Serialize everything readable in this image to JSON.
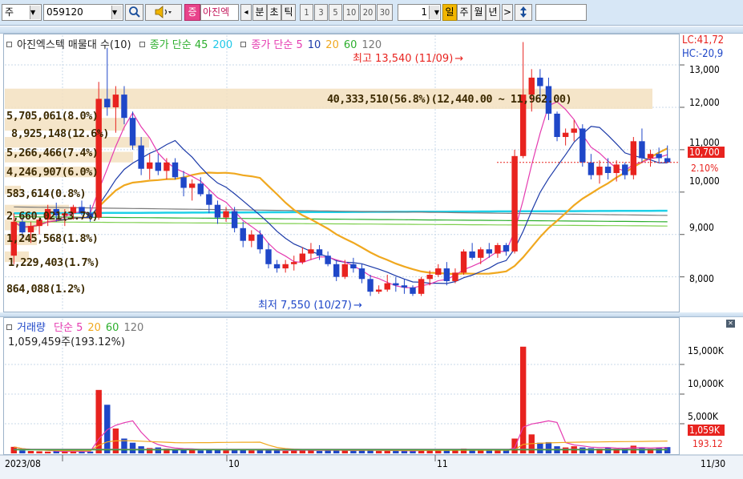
{
  "toolbar": {
    "market_code": "주",
    "stock_code": "059120",
    "search_icon": "magnifier-icon",
    "sound_icon": "speaker-icon",
    "kind_badge": "증",
    "stock_name": "아진엑",
    "prev_arrow": "◂",
    "unit_minute": "분",
    "unit_second": "초",
    "unit_tick": "틱",
    "intervals": [
      "1",
      "3",
      "5",
      "10",
      "20",
      "30"
    ],
    "interval_value": "1",
    "period_day": "일",
    "period_week": "주",
    "period_month": "월",
    "period_year": "년",
    "next_arrow": ">",
    "updown_icon": "up-down-arrow-icon"
  },
  "price_panel": {
    "legend_title": "아진엑스텍 매물대 수(10)",
    "ma_long_label": "종가 단순 45",
    "ma_long_value": "200",
    "ma_short_label": "종가 단순 5",
    "ma_short_periods": [
      "10",
      "20",
      "60",
      "120"
    ],
    "lc_label": "LC:41,72",
    "hc_label": "HC:-20,9",
    "y_ticks": [
      "13,000",
      "12,000",
      "11,000",
      "10,000",
      "9,000",
      "8,000"
    ],
    "current_price": "10,700",
    "current_change": "2.10%",
    "high_annotation": "최고 13,540 (11/09)",
    "low_annotation": "최저 7,550 (10/27)",
    "range_band_label": "40,333,510(56.8%)(12,440.00 ~ 11,962.00)",
    "profile_labels": [
      "5,705,061(8.0%)",
      "8,925,148(12.6%)",
      "5,266,466(7.4%)",
      "4,246,907(6.0%)",
      "583,614(0.8%)",
      "2,660,021(3.7%)",
      "1,245,568(1.8%)",
      "1,229,403(1.7%)",
      "864,088(1.2%)"
    ]
  },
  "volume_panel": {
    "legend_title": "거래량",
    "ma_label": "단순 5",
    "ma_periods": [
      "20",
      "60",
      "120"
    ],
    "current_volume": "1,059,459주(193.12%)",
    "y_ticks": [
      "15,000K",
      "10,000K",
      "5,000K"
    ],
    "current_tag": "1,059K",
    "ratio_tag": "193.12"
  },
  "x_axis": {
    "labels": [
      "2023/08",
      "10",
      "11",
      "11/30"
    ]
  },
  "colors": {
    "up": "#e8231f",
    "down": "#1f47c8",
    "ma5": "#e53bb0",
    "ma10": "#1c3aa8",
    "ma20": "#f0a81f",
    "ma60": "#2cae2c",
    "ma120": "#7a7a7a",
    "ma200": "#1ed0e8",
    "profile_band": "#f3e1c0",
    "toolbar_bg": "#d7e7f6"
  },
  "chart_data": {
    "type": "candlestick",
    "price_axis": {
      "ylim": [
        7200,
        13700
      ],
      "ticks": [
        13000,
        12000,
        11000,
        10000,
        9000,
        8000
      ]
    },
    "candles": [
      [
        8500,
        9500,
        8300,
        9300
      ],
      [
        9300,
        9400,
        8900,
        9050
      ],
      [
        9050,
        9300,
        8800,
        9200
      ],
      [
        9200,
        9400,
        9000,
        9350
      ],
      [
        9350,
        9700,
        9200,
        9600
      ],
      [
        9600,
        9750,
        9300,
        9450
      ],
      [
        9450,
        9600,
        9200,
        9500
      ],
      [
        9500,
        9700,
        9350,
        9650
      ],
      [
        9650,
        9800,
        9450,
        9500
      ],
      [
        9500,
        9700,
        9300,
        9400
      ],
      [
        9400,
        12600,
        9350,
        12200
      ],
      [
        12200,
        13400,
        11800,
        12000
      ],
      [
        12000,
        12500,
        11400,
        12300
      ],
      [
        12300,
        12500,
        11600,
        11750
      ],
      [
        11750,
        11900,
        11000,
        11100
      ],
      [
        11100,
        11300,
        10400,
        10550
      ],
      [
        10550,
        10900,
        10300,
        10700
      ],
      [
        10700,
        10900,
        10400,
        10500
      ],
      [
        10500,
        10800,
        10300,
        10700
      ],
      [
        10700,
        10800,
        10300,
        10350
      ],
      [
        10350,
        10500,
        9900,
        10100
      ],
      [
        10100,
        10300,
        9800,
        10200
      ],
      [
        10200,
        10350,
        9900,
        9950
      ],
      [
        9950,
        10050,
        9500,
        9700
      ],
      [
        9700,
        9800,
        9250,
        9400
      ],
      [
        9400,
        9650,
        9300,
        9550
      ],
      [
        9550,
        9650,
        9050,
        9150
      ],
      [
        9150,
        9300,
        8700,
        8850
      ],
      [
        8850,
        9100,
        8700,
        9000
      ],
      [
        9000,
        9100,
        8550,
        8650
      ],
      [
        8650,
        8800,
        8200,
        8300
      ],
      [
        8300,
        8400,
        8100,
        8200
      ],
      [
        8200,
        8400,
        8100,
        8300
      ],
      [
        8300,
        8500,
        8150,
        8350
      ],
      [
        8350,
        8700,
        8300,
        8550
      ],
      [
        8550,
        8800,
        8400,
        8650
      ],
      [
        8650,
        8750,
        8400,
        8500
      ],
      [
        8500,
        8600,
        8250,
        8300
      ],
      [
        8300,
        8400,
        7900,
        8000
      ],
      [
        8000,
        8400,
        7950,
        8300
      ],
      [
        8300,
        8450,
        8100,
        8200
      ],
      [
        8200,
        8300,
        7850,
        7950
      ],
      [
        7950,
        8050,
        7550,
        7650
      ],
      [
        7650,
        7800,
        7600,
        7700
      ],
      [
        7700,
        8050,
        7650,
        7850
      ],
      [
        7850,
        8000,
        7650,
        7800
      ],
      [
        7800,
        7950,
        7600,
        7750
      ],
      [
        7750,
        7800,
        7550,
        7600
      ],
      [
        7600,
        8000,
        7550,
        7950
      ],
      [
        7950,
        8150,
        7800,
        8050
      ],
      [
        8050,
        8300,
        8000,
        8200
      ],
      [
        8200,
        8350,
        7800,
        7900
      ],
      [
        7900,
        8200,
        7850,
        8100
      ],
      [
        8100,
        8650,
        8050,
        8600
      ],
      [
        8600,
        8800,
        8400,
        8450
      ],
      [
        8450,
        8700,
        8300,
        8650
      ],
      [
        8650,
        8800,
        8450,
        8550
      ],
      [
        8550,
        8800,
        8450,
        8750
      ],
      [
        8750,
        8800,
        8500,
        8600
      ],
      [
        8600,
        11000,
        8550,
        10850
      ],
      [
        10850,
        13540,
        10800,
        12300
      ],
      [
        12300,
        12900,
        11900,
        12700
      ],
      [
        12700,
        12900,
        12200,
        12500
      ],
      [
        12500,
        12700,
        11700,
        11850
      ],
      [
        11850,
        11900,
        11200,
        11300
      ],
      [
        11300,
        11500,
        11100,
        11400
      ],
      [
        11400,
        11700,
        11200,
        11500
      ],
      [
        11500,
        11600,
        10600,
        10700
      ],
      [
        10700,
        10900,
        10300,
        10400
      ],
      [
        10400,
        10750,
        10200,
        10600
      ],
      [
        10600,
        10800,
        10300,
        10450
      ],
      [
        10450,
        10750,
        10250,
        10650
      ],
      [
        10650,
        10700,
        10300,
        10400
      ],
      [
        10400,
        11300,
        10300,
        11200
      ],
      [
        11200,
        11500,
        10700,
        10800
      ],
      [
        10800,
        11000,
        10600,
        10900
      ],
      [
        10900,
        11050,
        10700,
        10800
      ],
      [
        10800,
        11100,
        10700,
        10700
      ]
    ],
    "volume_axis": {
      "ylim": [
        0,
        20000
      ],
      "unit": "K",
      "ticks": [
        15000,
        10000,
        5000
      ]
    },
    "volumes": [
      1100,
      500,
      400,
      350,
      300,
      350,
      300,
      380,
      320,
      300,
      10700,
      8200,
      4200,
      2500,
      1800,
      1200,
      900,
      1000,
      800,
      700,
      600,
      700,
      500,
      600,
      700,
      500,
      600,
      700,
      500,
      500,
      600,
      500,
      400,
      500,
      700,
      500,
      400,
      500,
      600,
      500,
      400,
      500,
      700,
      400,
      400,
      400,
      400,
      500,
      700,
      600,
      500,
      500,
      600,
      800,
      600,
      500,
      500,
      600,
      500,
      2500,
      18000,
      3200,
      1800,
      1900,
      1200,
      1000,
      1200,
      1000,
      900,
      800,
      1000,
      800,
      800,
      1300,
      900,
      800,
      900,
      1059
    ],
    "x_labels": [
      "2023/08",
      "10",
      "11",
      "11/30"
    ]
  }
}
